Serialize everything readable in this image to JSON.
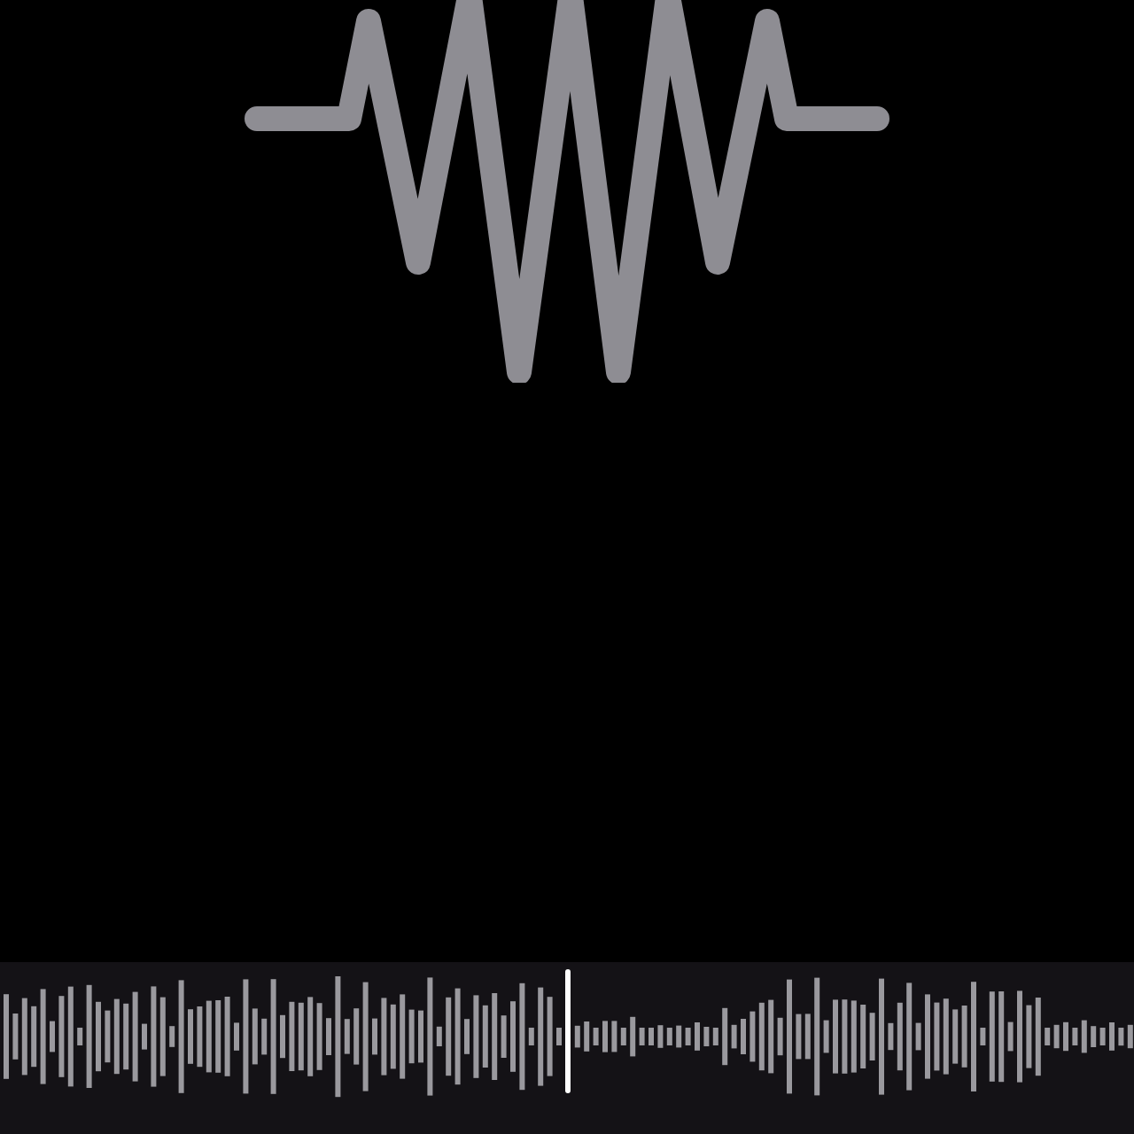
{
  "scrubber": {
    "level": 0.5
  }
}
